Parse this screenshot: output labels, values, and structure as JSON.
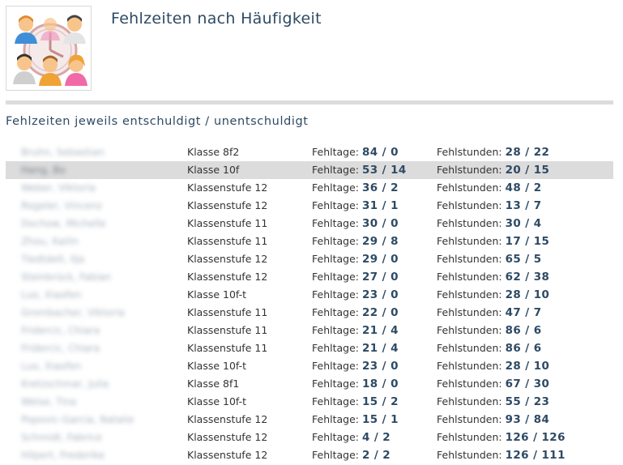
{
  "header": {
    "title": "Fehlzeiten nach Häufigkeit",
    "logo_icon": "users-clock-icon"
  },
  "section": {
    "title": "Fehlzeiten jeweils entschuldigt / unentschuldigt"
  },
  "labels": {
    "fehltage": "Fehltage:",
    "fehlstunden": "Fehlstunden:"
  },
  "colors": {
    "accent": "#2e4a64",
    "highlight_row": "#dcdcdc"
  },
  "rows": [
    {
      "name": "Bruhn, Sebastian",
      "klasse": "Klasse 8f2",
      "fehltage": "84 / 0",
      "fehlstunden": "28 / 22"
    },
    {
      "name": "Hang, Bo",
      "klasse": "Klasse 10f",
      "fehltage": "53 / 14",
      "fehlstunden": "20 / 15",
      "highlight": true
    },
    {
      "name": "Weber, Viktoria",
      "klasse": "Klassenstufe 12",
      "fehltage": "36 / 2",
      "fehlstunden": "48 / 2"
    },
    {
      "name": "Rogeler, Vincenz",
      "klasse": "Klassenstufe 12",
      "fehltage": "31 / 1",
      "fehlstunden": "13 / 7"
    },
    {
      "name": "Dochow, Michelle",
      "klasse": "Klassenstufe 11",
      "fehltage": "30 / 0",
      "fehlstunden": "30 / 4"
    },
    {
      "name": "Zhou, Kailin",
      "klasse": "Klassenstufe 11",
      "fehltage": "29 / 8",
      "fehlstunden": "17 / 15"
    },
    {
      "name": "Tiedtdelt, Ilja",
      "klasse": "Klassenstufe 12",
      "fehltage": "29 / 0",
      "fehlstunden": "65 / 5"
    },
    {
      "name": "Steinbrück, Fabian",
      "klasse": "Klassenstufe 12",
      "fehltage": "27 / 0",
      "fehlstunden": "62 / 38"
    },
    {
      "name": "Luo, Xiaofen",
      "klasse": "Klasse 10f-t",
      "fehltage": "23 / 0",
      "fehlstunden": "28 / 10"
    },
    {
      "name": "Grombacher, Viktoria",
      "klasse": "Klassenstufe 11",
      "fehltage": "22 / 0",
      "fehlstunden": "47 / 7"
    },
    {
      "name": "Fridercic, Chiara",
      "klasse": "Klassenstufe 11",
      "fehltage": "21 / 4",
      "fehlstunden": "86 / 6"
    },
    {
      "name": "Fridercic, Chiara",
      "klasse": "Klassenstufe 11",
      "fehltage": "21 / 4",
      "fehlstunden": "86 / 6"
    },
    {
      "name": "Luo, Xiaofen",
      "klasse": "Klasse 10f-t",
      "fehltage": "23 / 0",
      "fehlstunden": "28 / 10"
    },
    {
      "name": "Kretzschmar, Julia",
      "klasse": "Klasse 8f1",
      "fehltage": "18 / 0",
      "fehlstunden": "67 / 30"
    },
    {
      "name": "Weise, Tina",
      "klasse": "Klasse 10f-t",
      "fehltage": "15 / 2",
      "fehlstunden": "55 / 23"
    },
    {
      "name": "Popovic-Garcia, Natalie",
      "klasse": "Klassenstufe 12",
      "fehltage": "15 / 1",
      "fehlstunden": "93 / 84"
    },
    {
      "name": "Schmidt, Fabrice",
      "klasse": "Klassenstufe 12",
      "fehltage": "4 / 2",
      "fehlstunden": "126 / 126"
    },
    {
      "name": "Hilpert, Frederike",
      "klasse": "Klassenstufe 12",
      "fehltage": "2 / 2",
      "fehlstunden": "126 / 111"
    }
  ]
}
